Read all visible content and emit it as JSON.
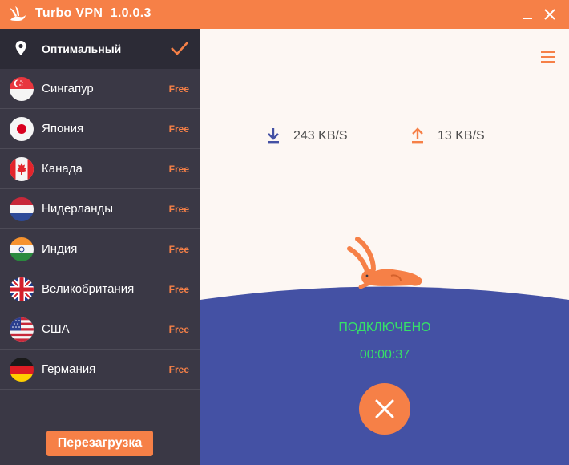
{
  "app": {
    "title": "Turbo VPN  1.0.0.3",
    "accent_color": "#f68047",
    "sidebar_color": "#3a3845",
    "connected_bg_color": "#4451a4"
  },
  "servers": [
    {
      "name": "Оптимальный",
      "icon": "location-pin-icon",
      "selected": true,
      "check_icon": "checkmark-icon"
    },
    {
      "name": "Сингапур",
      "badge": "Free",
      "flag": "singapore-flag-icon"
    },
    {
      "name": "Япония",
      "badge": "Free",
      "flag": "japan-flag-icon"
    },
    {
      "name": "Канада",
      "badge": "Free",
      "flag": "canada-flag-icon"
    },
    {
      "name": "Нидерланды",
      "badge": "Free",
      "flag": "netherlands-flag-icon"
    },
    {
      "name": "Индия",
      "badge": "Free",
      "flag": "india-flag-icon"
    },
    {
      "name": "Великобритания",
      "badge": "Free",
      "flag": "uk-flag-icon"
    },
    {
      "name": "США",
      "badge": "Free",
      "flag": "usa-flag-icon"
    },
    {
      "name": "Германия",
      "badge": "Free",
      "flag": "germany-flag-icon"
    }
  ],
  "reboot_label": "Перезагрузка",
  "stats": {
    "download": "243 KB/S",
    "upload": "13 KB/S",
    "download_color": "#4451a4",
    "upload_color": "#f68047"
  },
  "connection": {
    "status": "ПОДКЛЮЧЕНО",
    "timer": "00:00:37",
    "status_color": "#36e068"
  }
}
